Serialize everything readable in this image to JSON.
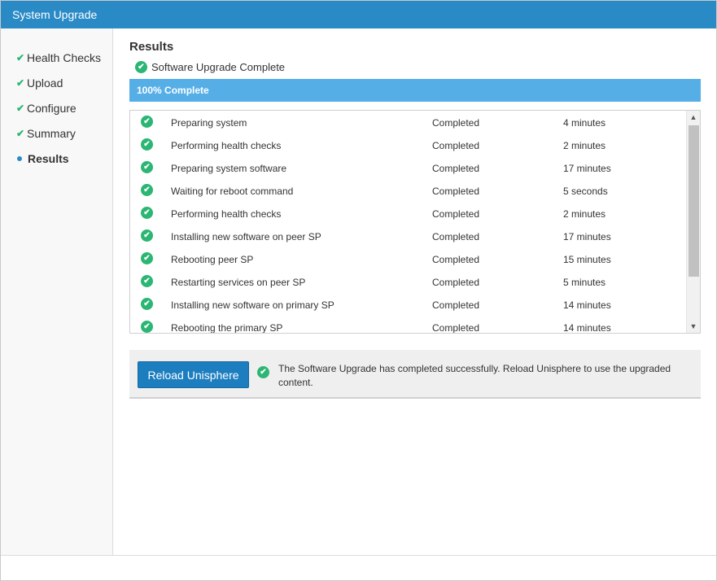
{
  "window": {
    "title": "System Upgrade"
  },
  "steps": [
    {
      "label": "Health Checks",
      "state": "done"
    },
    {
      "label": "Upload",
      "state": "done"
    },
    {
      "label": "Configure",
      "state": "done"
    },
    {
      "label": "Summary",
      "state": "done"
    },
    {
      "label": "Results",
      "state": "current"
    }
  ],
  "results": {
    "title": "Results",
    "status_text": "Software Upgrade Complete",
    "progress_label": "100% Complete",
    "progress_percent": 100
  },
  "tasks": [
    {
      "name": "Preparing system",
      "status": "Completed",
      "duration": "4 minutes"
    },
    {
      "name": "Performing health checks",
      "status": "Completed",
      "duration": "2 minutes"
    },
    {
      "name": "Preparing system software",
      "status": "Completed",
      "duration": "17 minutes"
    },
    {
      "name": "Waiting for reboot command",
      "status": "Completed",
      "duration": "5 seconds"
    },
    {
      "name": "Performing health checks",
      "status": "Completed",
      "duration": "2 minutes"
    },
    {
      "name": "Installing new software on peer SP",
      "status": "Completed",
      "duration": "17 minutes"
    },
    {
      "name": "Rebooting peer SP",
      "status": "Completed",
      "duration": "15 minutes"
    },
    {
      "name": "Restarting services on peer SP",
      "status": "Completed",
      "duration": "5 minutes"
    },
    {
      "name": "Installing new software on primary SP",
      "status": "Completed",
      "duration": "14 minutes"
    },
    {
      "name": "Rebooting the primary SP",
      "status": "Completed",
      "duration": "14 minutes"
    }
  ],
  "action": {
    "button_label": "Reload Unisphere",
    "message": "The Software Upgrade has completed successfully. Reload Unisphere to use the upgraded content."
  },
  "icons": {
    "check": "check-icon",
    "success": "success-icon",
    "current_step": "current-step-dot-icon",
    "scroll_up": "scroll-up-arrow-icon",
    "scroll_down": "scroll-down-arrow-icon"
  },
  "colors": {
    "titlebar": "#2a8ac6",
    "progress": "#56aee7",
    "success": "#2bb673",
    "button": "#1d7ebf"
  }
}
